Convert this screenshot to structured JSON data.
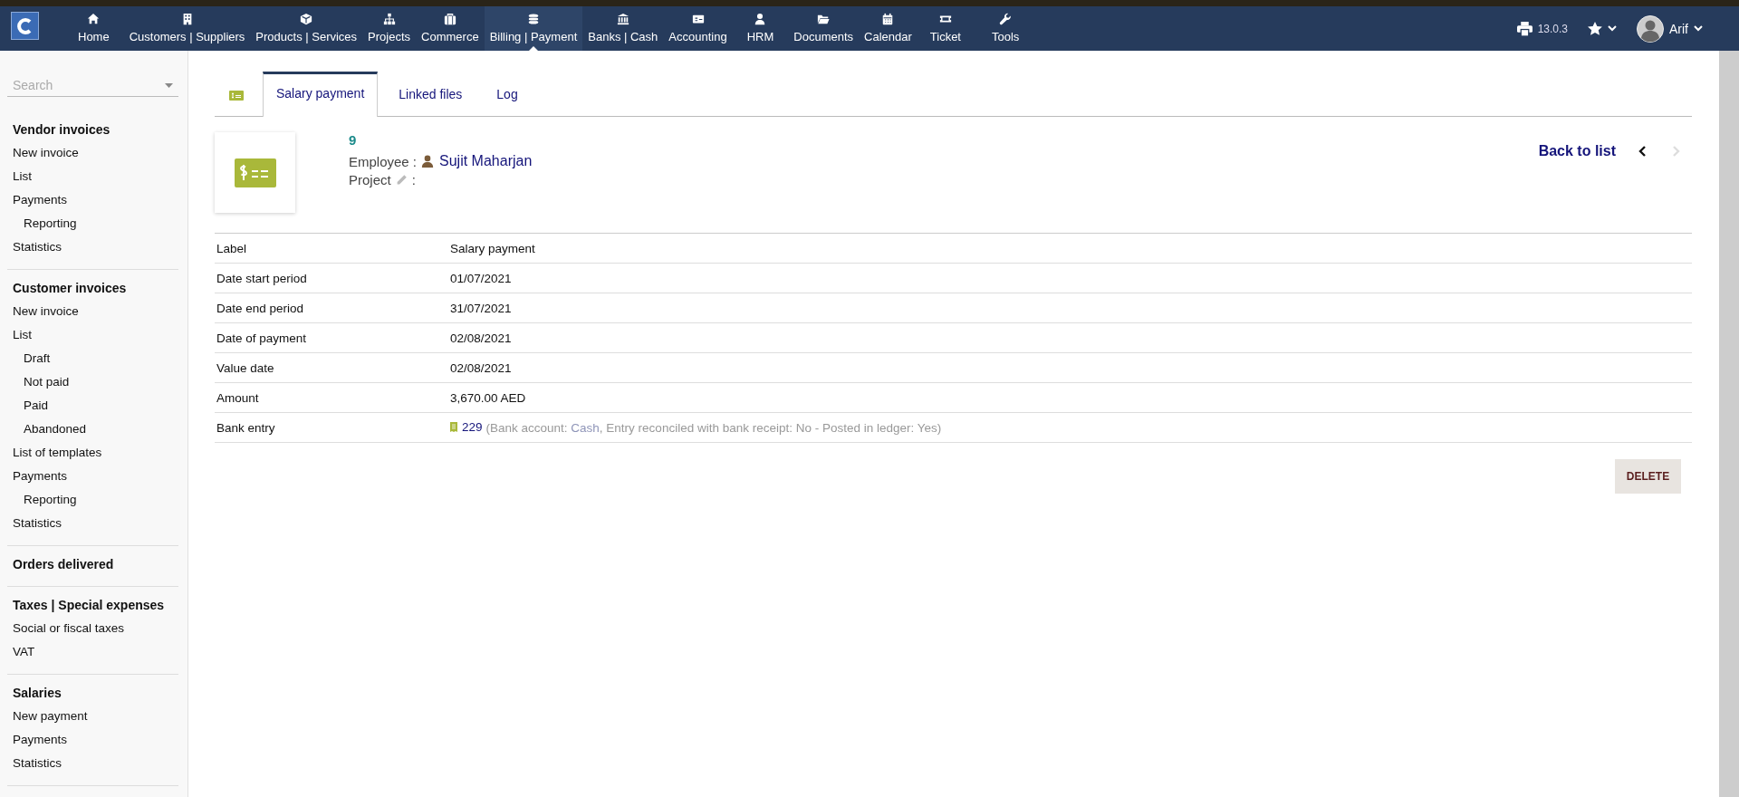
{
  "nav": {
    "items": [
      {
        "label": "Home",
        "selected": false
      },
      {
        "label": "Customers | Suppliers",
        "selected": false
      },
      {
        "label": "Products | Services",
        "selected": false
      },
      {
        "label": "Projects",
        "selected": false
      },
      {
        "label": "Commerce",
        "selected": false
      },
      {
        "label": "Billing | Payment",
        "selected": true
      },
      {
        "label": "Banks | Cash",
        "selected": false
      },
      {
        "label": "Accounting",
        "selected": false
      },
      {
        "label": "HRM",
        "selected": false
      },
      {
        "label": "Documents",
        "selected": false
      },
      {
        "label": "Calendar",
        "selected": false
      },
      {
        "label": "Ticket",
        "selected": false
      },
      {
        "label": "Tools",
        "selected": false
      }
    ],
    "version": "13.0.3",
    "user": "Arif"
  },
  "sidebar": {
    "search": {
      "placeholder": "Search"
    },
    "sections": [
      {
        "title": "Vendor invoices",
        "items": [
          {
            "label": "New invoice"
          },
          {
            "label": "List"
          },
          {
            "label": "Payments",
            "children": [
              {
                "label": "Reporting"
              }
            ]
          },
          {
            "label": "Statistics"
          }
        ]
      },
      {
        "title": "Customer invoices",
        "items": [
          {
            "label": "New invoice"
          },
          {
            "label": "List",
            "children": [
              {
                "label": "Draft"
              },
              {
                "label": "Not paid"
              },
              {
                "label": "Paid"
              },
              {
                "label": "Abandoned"
              }
            ]
          },
          {
            "label": "List of templates"
          },
          {
            "label": "Payments",
            "children": [
              {
                "label": "Reporting"
              }
            ]
          },
          {
            "label": "Statistics"
          }
        ]
      },
      {
        "title": "Orders delivered"
      },
      {
        "title": "Taxes | Special expenses",
        "items": [
          {
            "label": "Social or fiscal taxes"
          },
          {
            "label": "VAT"
          }
        ]
      },
      {
        "title": "Salaries",
        "items": [
          {
            "label": "New payment"
          },
          {
            "label": "Payments"
          },
          {
            "label": "Statistics"
          }
        ]
      }
    ]
  },
  "tabs": [
    {
      "label": "Salary payment",
      "selected": true
    },
    {
      "label": "Linked files",
      "selected": false
    },
    {
      "label": "Log",
      "selected": false
    }
  ],
  "record": {
    "ref": "9",
    "employee_label": "Employee :",
    "employee": "Sujit Maharjan",
    "project_label": "Project",
    "project_colon": ":",
    "back_to_list": "Back to list",
    "prev_disabled": false,
    "next_disabled": true
  },
  "fields": [
    {
      "label": "Label",
      "value": "Salary payment"
    },
    {
      "label": "Date start period",
      "value": "01/07/2021"
    },
    {
      "label": "Date end period",
      "value": "31/07/2021"
    },
    {
      "label": "Date of payment",
      "value": "02/08/2021"
    },
    {
      "label": "Value date",
      "value": "02/08/2021"
    },
    {
      "label": "Amount",
      "value": "3,670.00 AED"
    }
  ],
  "bank_entry": {
    "label": "Bank entry",
    "link": "229",
    "detail_prefix": "(Bank account:",
    "account": "Cash",
    "detail_suffix": ", Entry reconciled with bank receipt: No - Posted in ledger: Yes)"
  },
  "actions": [
    "DELETE"
  ]
}
